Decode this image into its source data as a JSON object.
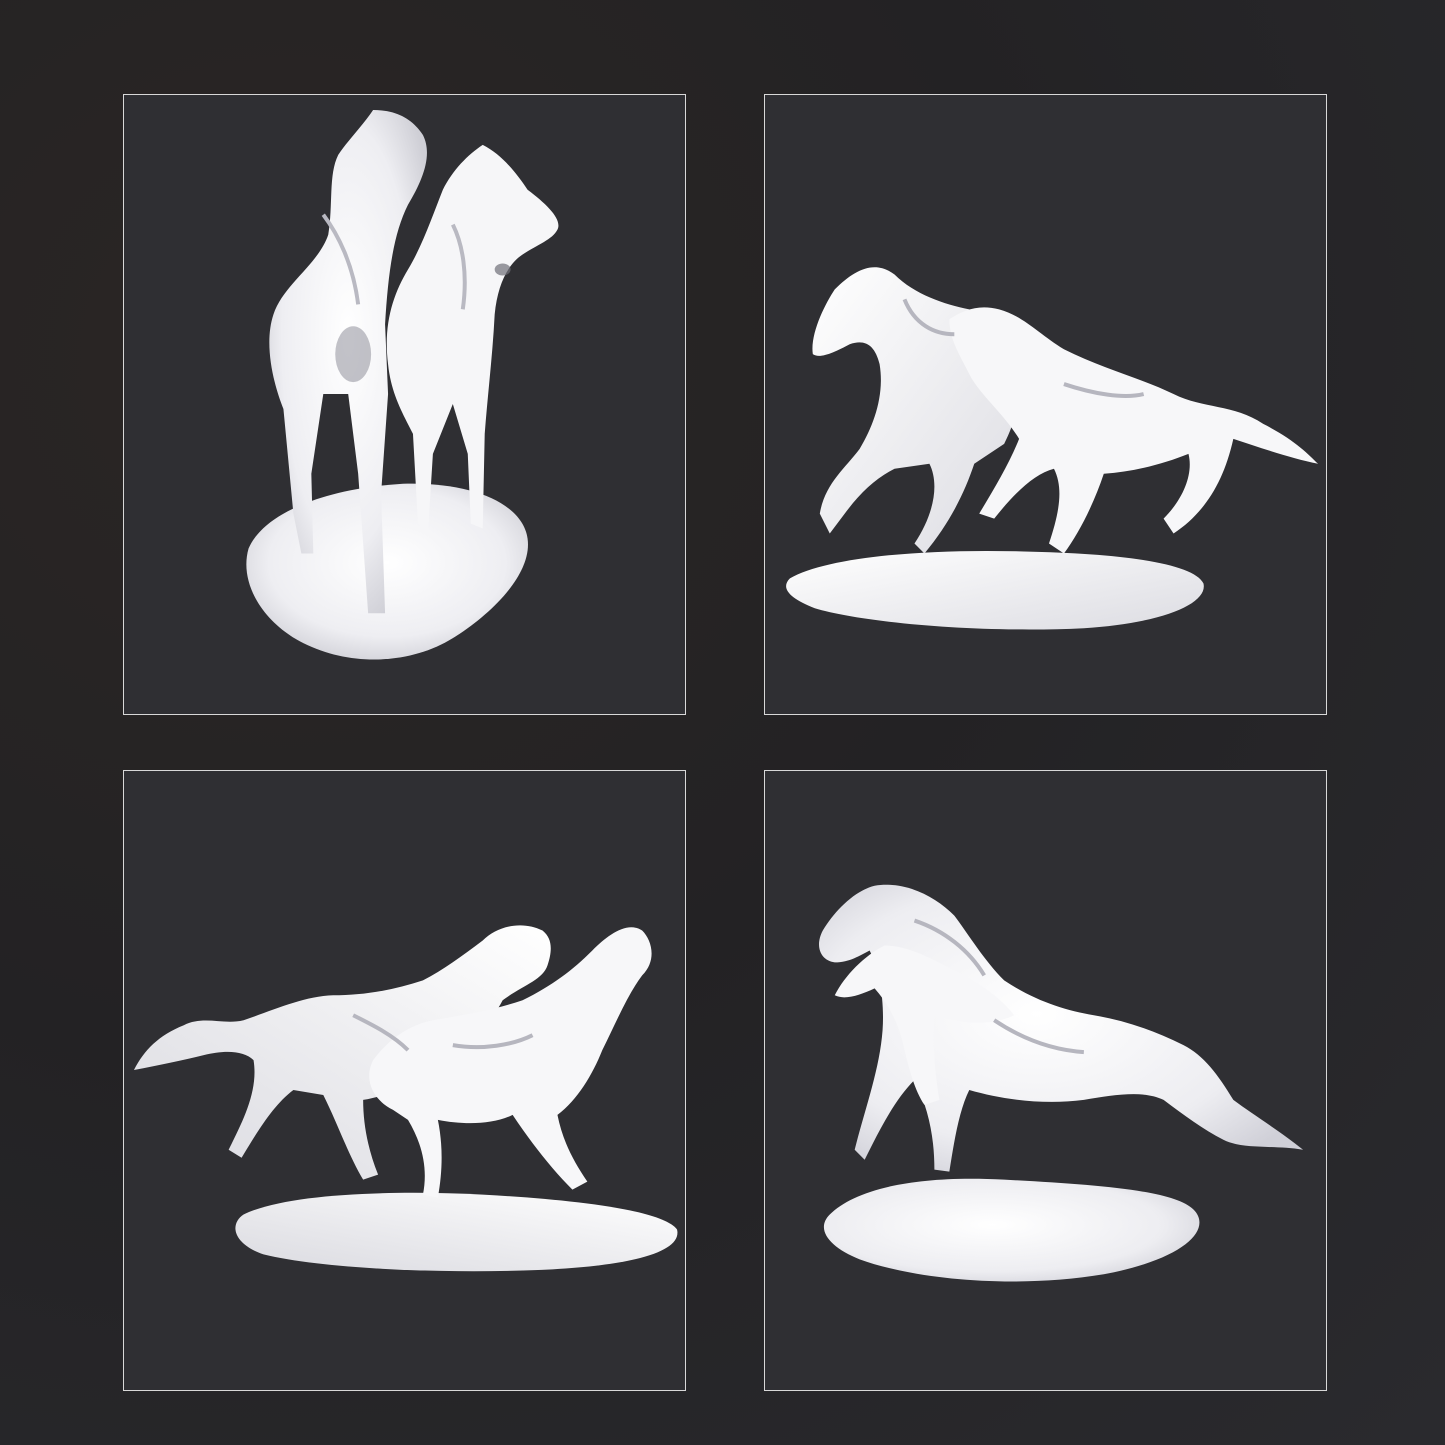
{
  "gallery": {
    "background_color": "#262527",
    "panel_background": "#2f2f33",
    "panel_border": "#d8d8d8",
    "figurine_color": "#f4f4f6",
    "panels": [
      {
        "subject": "two-horses-front-view"
      },
      {
        "subject": "two-horses-galloping-left"
      },
      {
        "subject": "two-horses-galloping-right"
      },
      {
        "subject": "two-horses-three-quarter-view"
      }
    ]
  }
}
